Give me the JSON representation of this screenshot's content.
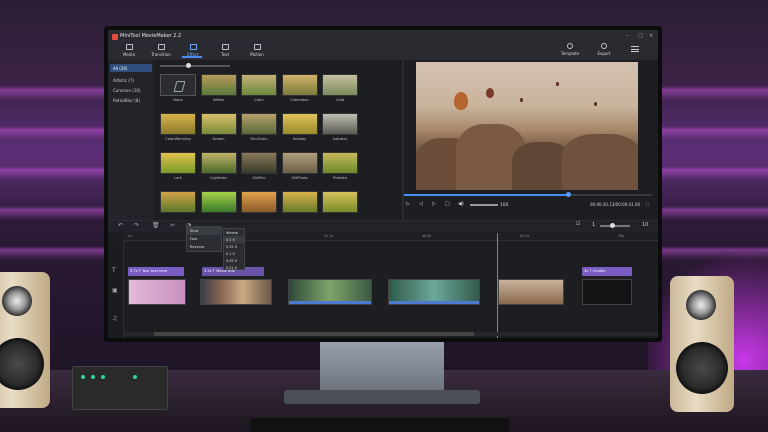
{
  "app": {
    "title": "MiniTool MovieMaker 2.2"
  },
  "toolbar": {
    "items": [
      {
        "label": "Media"
      },
      {
        "label": "Transition"
      },
      {
        "label": "Effect"
      },
      {
        "label": "Text"
      },
      {
        "label": "Motion"
      }
    ],
    "right": [
      {
        "label": "Template"
      },
      {
        "label": "Export"
      }
    ]
  },
  "categories": [
    {
      "label": "All (26)"
    },
    {
      "label": "Artistic (7)"
    },
    {
      "label": "Common (10)"
    },
    {
      "label": "Retro/Blur (8)"
    }
  ],
  "effects": [
    {
      "label": "None"
    },
    {
      "label": "Sefton"
    },
    {
      "label": "Calm"
    },
    {
      "label": "Clarendon"
    },
    {
      "label": "Cold"
    },
    {
      "label": "ColorWarming"
    },
    {
      "label": "Dream"
    },
    {
      "label": "FilmGrain"
    },
    {
      "label": "Holiday"
    },
    {
      "label": "Industry"
    },
    {
      "label": "Lark"
    },
    {
      "label": "Lighttree"
    },
    {
      "label": "OldFilm"
    },
    {
      "label": "OldPhoto"
    },
    {
      "label": "Pixelate"
    },
    {
      "label": ""
    },
    {
      "label": ""
    },
    {
      "label": ""
    },
    {
      "label": ""
    },
    {
      "label": ""
    }
  ],
  "player": {
    "volume": "100",
    "timecode": "00:00:30.13/00:00:41.06"
  },
  "timeline": {
    "zoom_min": "1",
    "zoom_max": "10",
    "ruler": [
      "0s",
      "",
      "15.6s",
      "",
      "31.2s",
      "",
      "46.8s",
      "",
      "62.4s",
      "",
      "78s"
    ],
    "text_clips": [
      {
        "label": "5.7s  T Your text here"
      },
      {
        "label": "3.3s  T Movie title"
      },
      {
        "label": "3s  T Credits"
      }
    ],
    "speed_menu": [
      {
        "label": "Slow"
      },
      {
        "label": "Fast"
      },
      {
        "label": "Reverse"
      }
    ],
    "speed_options": [
      {
        "label": "Normal"
      },
      {
        "label": "0.5 X"
      },
      {
        "label": "0.25 X"
      },
      {
        "label": "0.1 X"
      },
      {
        "label": "0.05 X"
      },
      {
        "label": "0.01 X"
      }
    ]
  },
  "colors": {
    "accent": "#4b8cf0",
    "text_clip": "#7b5cc4"
  }
}
